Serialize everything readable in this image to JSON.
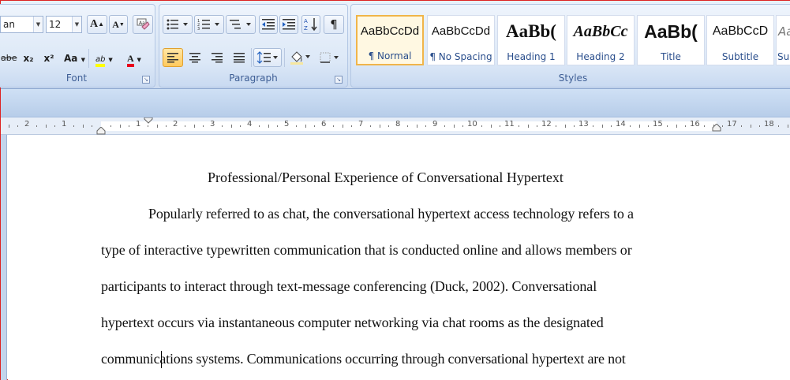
{
  "font_group": {
    "label": "Font",
    "font_name": "an",
    "font_size": "12",
    "grow_font_label": "A",
    "shrink_font_label": "A",
    "strikethrough_label": "abe",
    "subscript_label": "x₂",
    "superscript_label": "x²",
    "change_case_label": "Aa",
    "highlight_label": "ab",
    "font_color_label": "A"
  },
  "paragraph_group": {
    "label": "Paragraph",
    "pilcrow": "¶"
  },
  "styles_group": {
    "label": "Styles",
    "items": [
      {
        "sample": "AaBbCcDd",
        "name": "¶ Normal",
        "selected": true
      },
      {
        "sample": "AaBbCcDd",
        "name": "¶ No Spacing",
        "selected": false
      },
      {
        "sample": "AaBb(",
        "name": "Heading 1",
        "selected": false
      },
      {
        "sample": "AaBbCc",
        "name": "Heading 2",
        "selected": false
      },
      {
        "sample": "AaBb(",
        "name": "Title",
        "selected": false
      },
      {
        "sample": "AaBbCcD",
        "name": "Subtitle",
        "selected": false
      },
      {
        "sample": "Aa",
        "name": "Sub",
        "selected": false
      }
    ]
  },
  "ruler": {
    "left_numbers": [
      "2",
      "1"
    ],
    "right_numbers": [
      "1",
      "2",
      "3",
      "4",
      "5",
      "6",
      "7",
      "8",
      "9",
      "10",
      "11",
      "12",
      "13",
      "14",
      "15",
      "16",
      "17",
      "18"
    ]
  },
  "document": {
    "title": "Professional/Personal Experience of Conversational Hypertext",
    "lines": [
      "Popularly referred to as chat, the conversational hypertext access technology refers to a",
      "type of interactive typewritten communication that is conducted online and allows members  or",
      "participants to interact through text-message conferencing (Duck, 2002). Conversational",
      "hypertext occurs via instantaneous computer networking via chat rooms as the designated",
      "communications systems. Communications occurring through conversational hypertext are not"
    ]
  },
  "colors": {
    "highlight": "#ffff00",
    "font_color": "#e8001c",
    "ribbon_label": "#3e5e95"
  }
}
